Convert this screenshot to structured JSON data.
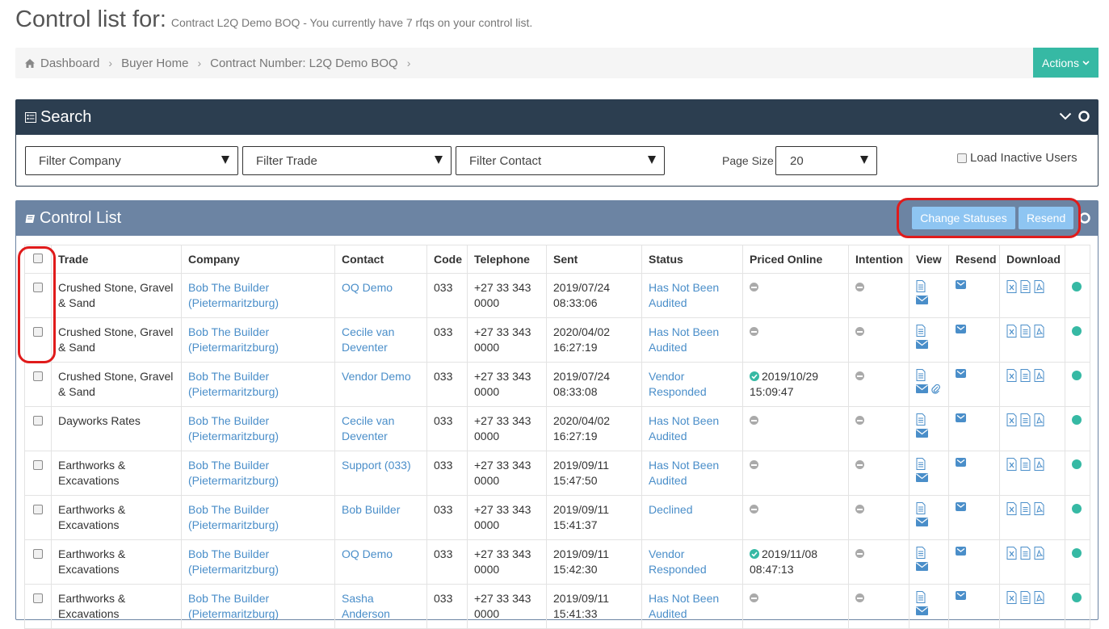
{
  "header": {
    "title": "Control list for:",
    "subtitle": "Contract L2Q Demo BOQ - You currently have 7 rfqs on your control list."
  },
  "breadcrumb": [
    "Dashboard",
    "Buyer Home",
    "Contract Number: L2Q Demo BOQ"
  ],
  "actions_label": "Actions",
  "search": {
    "title": "Search",
    "filter_company": "Filter Company",
    "filter_trade": "Filter Trade",
    "filter_contact": "Filter Contact",
    "page_size_label": "Page Size",
    "page_size_value": "20",
    "load_inactive_label": "Load Inactive Users"
  },
  "control_list": {
    "title": "Control List",
    "change_statuses_label": "Change Statuses",
    "resend_label": "Resend",
    "columns": [
      "Trade",
      "Company",
      "Contact",
      "Code",
      "Telephone",
      "Sent",
      "Status",
      "Priced Online",
      "Intention",
      "View",
      "Resend",
      "Download"
    ],
    "rows": [
      {
        "trade": "Crushed Stone, Gravel & Sand",
        "company": "Bob The Builder (Pietermaritzburg)",
        "contact": "OQ Demo",
        "code": "033",
        "telephone": "+27 33 343 0000",
        "sent": "2019/07/24 08:33:06",
        "status": "Has Not Been Audited",
        "priced_online": "",
        "attachment": false
      },
      {
        "trade": "Crushed Stone, Gravel & Sand",
        "company": "Bob The Builder (Pietermaritzburg)",
        "contact": "Cecile van Deventer",
        "code": "033",
        "telephone": "+27 33 343 0000",
        "sent": "2020/04/02 16:27:19",
        "status": "Has Not Been Audited",
        "priced_online": "",
        "attachment": false
      },
      {
        "trade": "Crushed Stone, Gravel & Sand",
        "company": "Bob The Builder (Pietermaritzburg)",
        "contact": "Vendor Demo",
        "code": "033",
        "telephone": "+27 33 343 0000",
        "sent": "2019/07/24 08:33:08",
        "status": "Vendor Responded",
        "priced_online": "2019/10/29 15:09:47",
        "attachment": true
      },
      {
        "trade": "Dayworks Rates",
        "company": "Bob The Builder (Pietermaritzburg)",
        "contact": "Cecile van Deventer",
        "code": "033",
        "telephone": "+27 33 343 0000",
        "sent": "2020/04/02 16:27:19",
        "status": "Has Not Been Audited",
        "priced_online": "",
        "attachment": false
      },
      {
        "trade": "Earthworks & Excavations",
        "company": "Bob The Builder (Pietermaritzburg)",
        "contact": "Support (033)",
        "code": "033",
        "telephone": "+27 33 343 0000",
        "sent": "2019/09/11 15:47:50",
        "status": "Has Not Been Audited",
        "priced_online": "",
        "attachment": false
      },
      {
        "trade": "Earthworks & Excavations",
        "company": "Bob The Builder (Pietermaritzburg)",
        "contact": "Bob Builder",
        "code": "033",
        "telephone": "+27 33 343 0000",
        "sent": "2019/09/11 15:41:37",
        "status": "Declined",
        "priced_online": "",
        "attachment": false
      },
      {
        "trade": "Earthworks & Excavations",
        "company": "Bob The Builder (Pietermaritzburg)",
        "contact": "OQ Demo",
        "code": "033",
        "telephone": "+27 33 343 0000",
        "sent": "2019/09/11 15:42:30",
        "status": "Vendor Responded",
        "priced_online": "2019/11/08 08:47:13",
        "attachment": false
      },
      {
        "trade": "Earthworks & Excavations",
        "company": "Bob The Builder (Pietermaritzburg)",
        "contact": "Sasha Anderson",
        "code": "033",
        "telephone": "+27 33 343 0000",
        "sent": "2019/09/11 15:41:33",
        "status": "Has Not Been Audited",
        "priced_online": "",
        "attachment": false
      }
    ]
  },
  "colors": {
    "accent": "#36b9a4",
    "link": "#4a8ec9",
    "search_header": "#2c3e50",
    "list_header": "#6c84a3",
    "highlight": "#e01b1b"
  }
}
